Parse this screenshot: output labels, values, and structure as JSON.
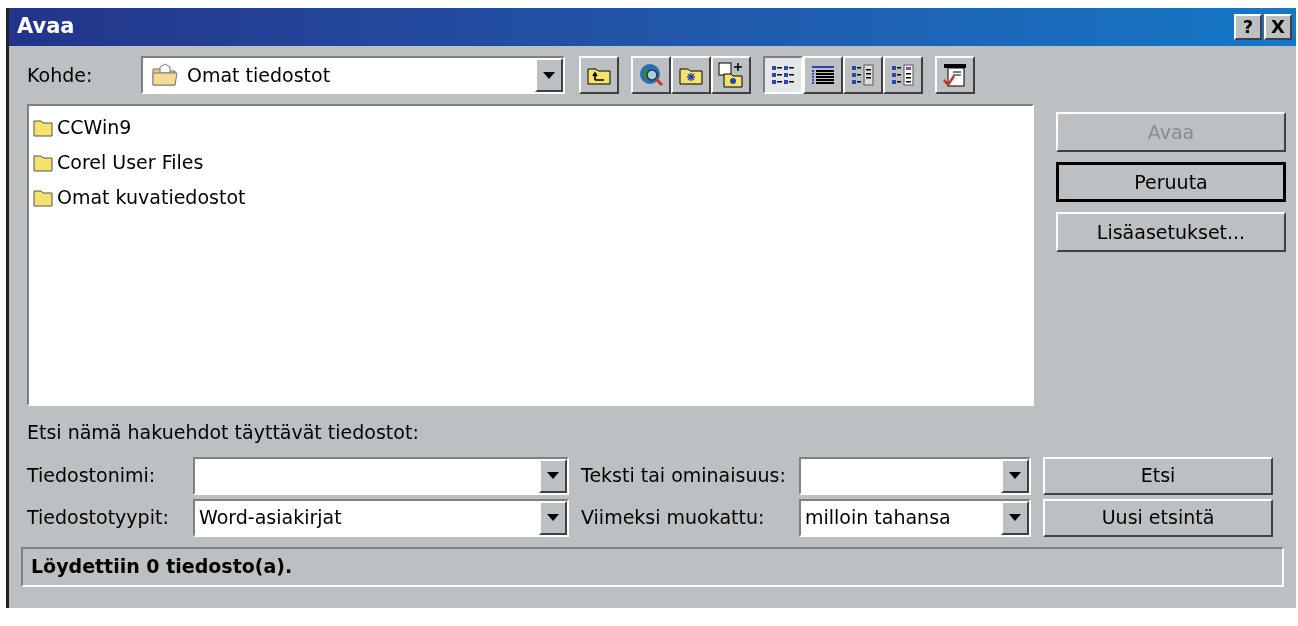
{
  "window": {
    "title": "Avaa",
    "help_button": "?",
    "close_button": "X"
  },
  "location": {
    "label": "Kohde:",
    "value": "Omat tiedostot"
  },
  "toolbar": {
    "actions": [
      {
        "kind": "up"
      },
      {
        "kind": "web"
      },
      {
        "kind": "new-folder"
      },
      {
        "kind": "favorites"
      }
    ],
    "views": [
      {
        "kind": "list",
        "selected": true
      },
      {
        "kind": "details",
        "selected": false
      },
      {
        "kind": "properties",
        "selected": false
      },
      {
        "kind": "preview",
        "selected": false
      }
    ],
    "tools": {
      "kind": "tools"
    }
  },
  "files": [
    {
      "name": "CCWin9",
      "selected": false
    },
    {
      "name": "Corel User Files",
      "selected": false
    },
    {
      "name": "Omat kuvatiedostot",
      "selected": false
    }
  ],
  "side_buttons": [
    {
      "label": "Avaa",
      "disabled": true,
      "default": false
    },
    {
      "label": "Peruuta",
      "disabled": false,
      "default": true
    },
    {
      "label": "Lisäasetukset...",
      "disabled": false,
      "default": false
    }
  ],
  "search": {
    "heading": "Etsi nämä hakuehdot täyttävät tiedostot:",
    "fields": [
      {
        "label": "Tiedostonimi:"
      },
      {
        "label": "Teksti tai ominaisuus:"
      },
      {
        "label": "Tiedostotyypit:",
        "value": "Word-asiakirjat"
      },
      {
        "label": "Viimeksi muokattu:",
        "value": "milloin tahansa"
      }
    ],
    "buttons": [
      "Etsi",
      "Uusi etsintä"
    ]
  },
  "status_bar": "Löydettiin 0 tiedosto(a)."
}
